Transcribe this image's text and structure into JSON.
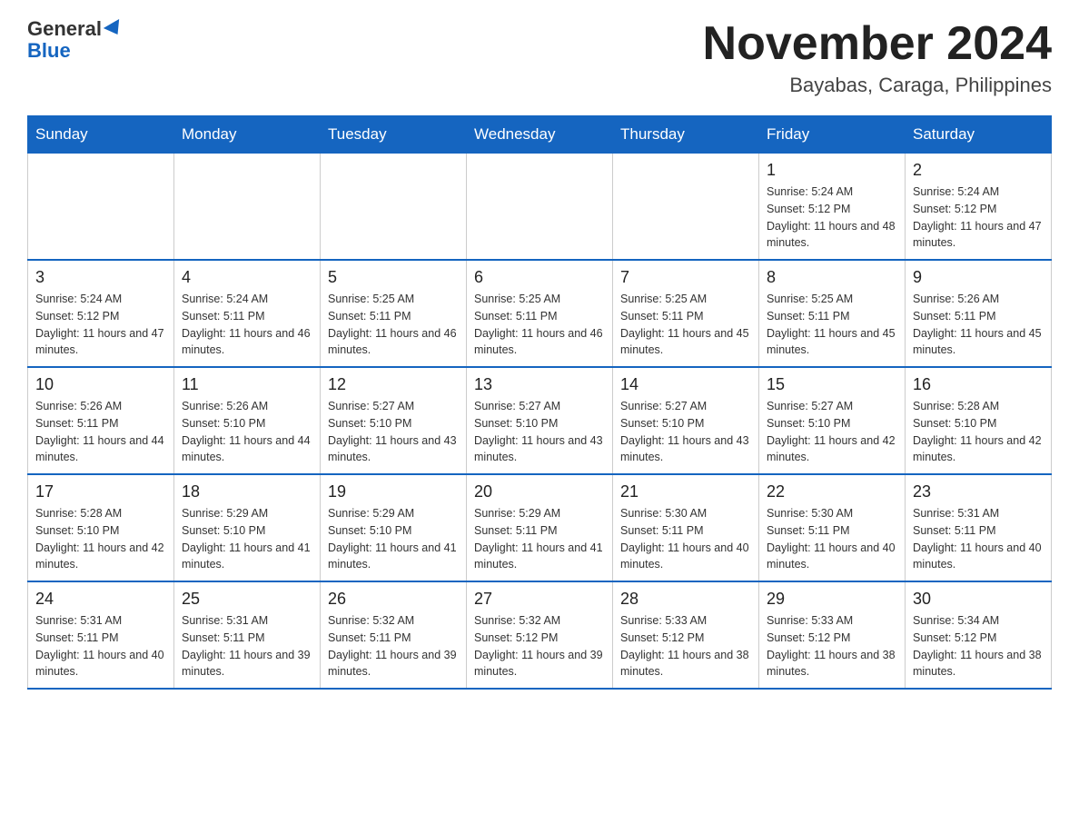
{
  "header": {
    "logo_general": "General",
    "logo_blue": "Blue",
    "month_title": "November 2024",
    "location": "Bayabas, Caraga, Philippines"
  },
  "weekdays": [
    "Sunday",
    "Monday",
    "Tuesday",
    "Wednesday",
    "Thursday",
    "Friday",
    "Saturday"
  ],
  "weeks": [
    [
      {
        "day": "",
        "info": ""
      },
      {
        "day": "",
        "info": ""
      },
      {
        "day": "",
        "info": ""
      },
      {
        "day": "",
        "info": ""
      },
      {
        "day": "",
        "info": ""
      },
      {
        "day": "1",
        "info": "Sunrise: 5:24 AM\nSunset: 5:12 PM\nDaylight: 11 hours and 48 minutes."
      },
      {
        "day": "2",
        "info": "Sunrise: 5:24 AM\nSunset: 5:12 PM\nDaylight: 11 hours and 47 minutes."
      }
    ],
    [
      {
        "day": "3",
        "info": "Sunrise: 5:24 AM\nSunset: 5:12 PM\nDaylight: 11 hours and 47 minutes."
      },
      {
        "day": "4",
        "info": "Sunrise: 5:24 AM\nSunset: 5:11 PM\nDaylight: 11 hours and 46 minutes."
      },
      {
        "day": "5",
        "info": "Sunrise: 5:25 AM\nSunset: 5:11 PM\nDaylight: 11 hours and 46 minutes."
      },
      {
        "day": "6",
        "info": "Sunrise: 5:25 AM\nSunset: 5:11 PM\nDaylight: 11 hours and 46 minutes."
      },
      {
        "day": "7",
        "info": "Sunrise: 5:25 AM\nSunset: 5:11 PM\nDaylight: 11 hours and 45 minutes."
      },
      {
        "day": "8",
        "info": "Sunrise: 5:25 AM\nSunset: 5:11 PM\nDaylight: 11 hours and 45 minutes."
      },
      {
        "day": "9",
        "info": "Sunrise: 5:26 AM\nSunset: 5:11 PM\nDaylight: 11 hours and 45 minutes."
      }
    ],
    [
      {
        "day": "10",
        "info": "Sunrise: 5:26 AM\nSunset: 5:11 PM\nDaylight: 11 hours and 44 minutes."
      },
      {
        "day": "11",
        "info": "Sunrise: 5:26 AM\nSunset: 5:10 PM\nDaylight: 11 hours and 44 minutes."
      },
      {
        "day": "12",
        "info": "Sunrise: 5:27 AM\nSunset: 5:10 PM\nDaylight: 11 hours and 43 minutes."
      },
      {
        "day": "13",
        "info": "Sunrise: 5:27 AM\nSunset: 5:10 PM\nDaylight: 11 hours and 43 minutes."
      },
      {
        "day": "14",
        "info": "Sunrise: 5:27 AM\nSunset: 5:10 PM\nDaylight: 11 hours and 43 minutes."
      },
      {
        "day": "15",
        "info": "Sunrise: 5:27 AM\nSunset: 5:10 PM\nDaylight: 11 hours and 42 minutes."
      },
      {
        "day": "16",
        "info": "Sunrise: 5:28 AM\nSunset: 5:10 PM\nDaylight: 11 hours and 42 minutes."
      }
    ],
    [
      {
        "day": "17",
        "info": "Sunrise: 5:28 AM\nSunset: 5:10 PM\nDaylight: 11 hours and 42 minutes."
      },
      {
        "day": "18",
        "info": "Sunrise: 5:29 AM\nSunset: 5:10 PM\nDaylight: 11 hours and 41 minutes."
      },
      {
        "day": "19",
        "info": "Sunrise: 5:29 AM\nSunset: 5:10 PM\nDaylight: 11 hours and 41 minutes."
      },
      {
        "day": "20",
        "info": "Sunrise: 5:29 AM\nSunset: 5:11 PM\nDaylight: 11 hours and 41 minutes."
      },
      {
        "day": "21",
        "info": "Sunrise: 5:30 AM\nSunset: 5:11 PM\nDaylight: 11 hours and 40 minutes."
      },
      {
        "day": "22",
        "info": "Sunrise: 5:30 AM\nSunset: 5:11 PM\nDaylight: 11 hours and 40 minutes."
      },
      {
        "day": "23",
        "info": "Sunrise: 5:31 AM\nSunset: 5:11 PM\nDaylight: 11 hours and 40 minutes."
      }
    ],
    [
      {
        "day": "24",
        "info": "Sunrise: 5:31 AM\nSunset: 5:11 PM\nDaylight: 11 hours and 40 minutes."
      },
      {
        "day": "25",
        "info": "Sunrise: 5:31 AM\nSunset: 5:11 PM\nDaylight: 11 hours and 39 minutes."
      },
      {
        "day": "26",
        "info": "Sunrise: 5:32 AM\nSunset: 5:11 PM\nDaylight: 11 hours and 39 minutes."
      },
      {
        "day": "27",
        "info": "Sunrise: 5:32 AM\nSunset: 5:12 PM\nDaylight: 11 hours and 39 minutes."
      },
      {
        "day": "28",
        "info": "Sunrise: 5:33 AM\nSunset: 5:12 PM\nDaylight: 11 hours and 38 minutes."
      },
      {
        "day": "29",
        "info": "Sunrise: 5:33 AM\nSunset: 5:12 PM\nDaylight: 11 hours and 38 minutes."
      },
      {
        "day": "30",
        "info": "Sunrise: 5:34 AM\nSunset: 5:12 PM\nDaylight: 11 hours and 38 minutes."
      }
    ]
  ]
}
